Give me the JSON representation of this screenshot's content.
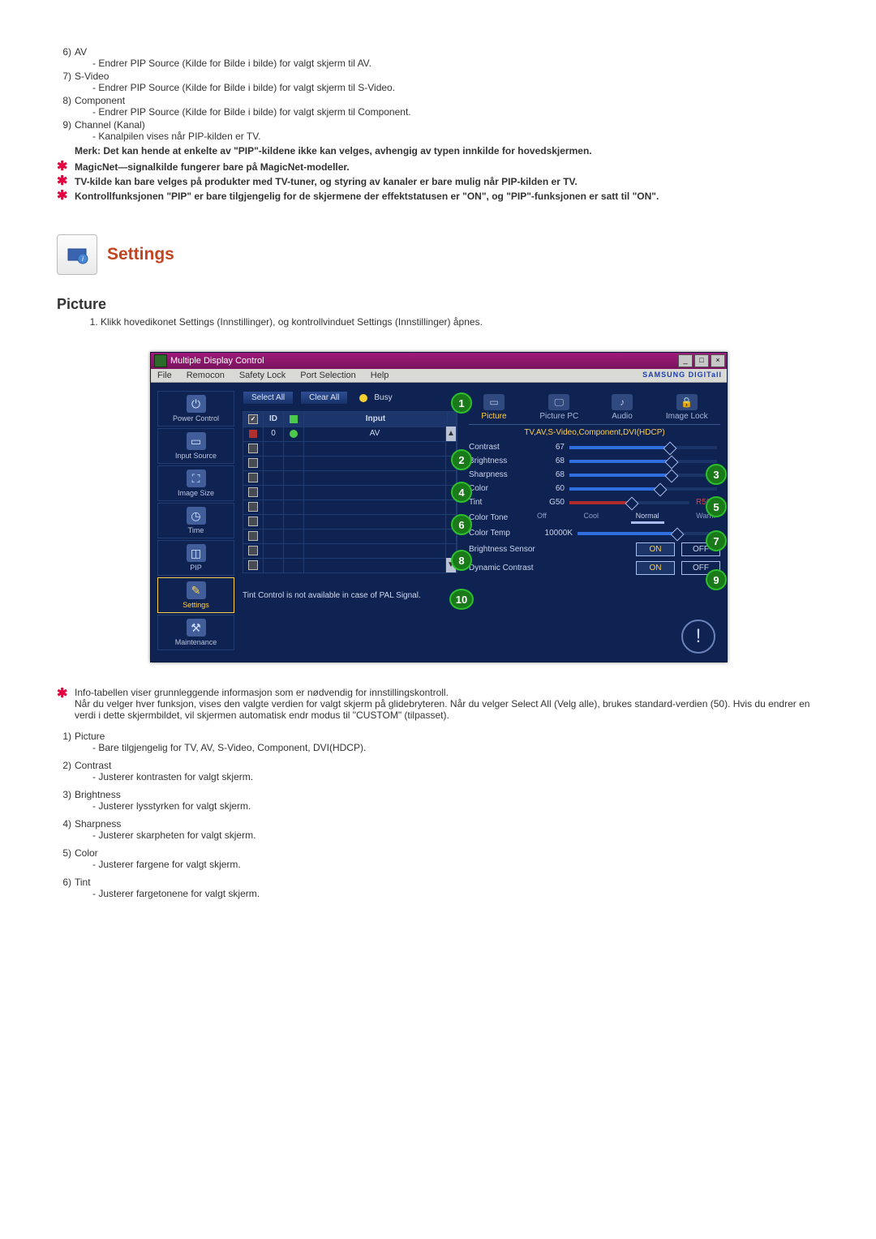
{
  "top_list": [
    {
      "num": "6)",
      "label": "AV",
      "desc": "- Endrer PIP Source (Kilde for Bilde i bilde) for valgt skjerm til AV."
    },
    {
      "num": "7)",
      "label": "S-Video",
      "desc": "- Endrer PIP Source (Kilde for Bilde i bilde) for valgt skjerm til S-Video."
    },
    {
      "num": "8)",
      "label": "Component",
      "desc": "- Endrer PIP Source (Kilde for Bilde i bilde) for valgt skjerm til Component."
    },
    {
      "num": "9)",
      "label": "Channel (Kanal)",
      "desc": "- Kanalpilen vises når PIP-kilden er TV."
    }
  ],
  "merk": "Merk: Det kan hende at enkelte av \"PIP\"-kildene ikke kan velges, avhengig av typen innkilde for hovedskjermen.",
  "star_notes": [
    "MagicNet—signalkilde fungerer bare på MagicNet-modeller.",
    "TV-kilde kan bare velges på produkter med TV-tuner, og styring av kanaler er bare mulig når PIP-kilden er TV.",
    "Kontrollfunksjonen \"PIP\" er bare tilgjengelig for de skjermene der effektstatusen er \"ON\", og \"PIP\"-funksjonen er satt til \"ON\"."
  ],
  "section_title": "Settings",
  "subsection_title": "Picture",
  "subsection_step": "Klikk hovedikonet Settings (Innstillinger), og kontrollvinduet Settings (Innstillinger) åpnes.",
  "app": {
    "title": "Multiple Display Control",
    "menu": [
      "File",
      "Remocon",
      "Safety Lock",
      "Port Selection",
      "Help"
    ],
    "brand": "SAMSUNG DIGITall",
    "sidebar": [
      {
        "label": "Power Control"
      },
      {
        "label": "Input Source"
      },
      {
        "label": "Image Size"
      },
      {
        "label": "Time"
      },
      {
        "label": "PIP"
      },
      {
        "label": "Settings"
      },
      {
        "label": "Maintenance"
      }
    ],
    "buttons": {
      "select_all": "Select All",
      "clear_all": "Clear All",
      "busy": "Busy"
    },
    "grid_headers": {
      "c1": "",
      "c2": "ID",
      "c3": "",
      "c4": "Input"
    },
    "grid_row1": {
      "id": "0",
      "input": "AV"
    },
    "tabs": [
      "Picture",
      "Picture PC",
      "Audio",
      "Image Lock"
    ],
    "panel_head": "TV,AV,S-Video,Component,DVI(HDCP)",
    "rows": {
      "contrast": {
        "label": "Contrast",
        "val": "67"
      },
      "brightness": {
        "label": "Brightness",
        "val": "68"
      },
      "sharpness": {
        "label": "Sharpness",
        "val": "68"
      },
      "color": {
        "label": "Color",
        "val": "60"
      },
      "tint": {
        "label": "Tint",
        "valL": "G50",
        "valR": "R50"
      },
      "colortone": {
        "label": "Color Tone",
        "opts": [
          "Off",
          "Cool",
          "Normal",
          "Warm"
        ]
      },
      "colortemp": {
        "label": "Color Temp",
        "val": "10000K"
      },
      "bsensor": {
        "label": "Brightness Sensor",
        "on": "ON",
        "off": "OFF"
      },
      "dcontrast": {
        "label": "Dynamic Contrast",
        "on": "ON",
        "off": "OFF"
      }
    },
    "footer_note": "Tint Control is not available in case of PAL Signal."
  },
  "post_star": "Info-tabellen viser grunnleggende informasjon som er nødvendig for innstillingskontroll.\nNår du velger hver funksjon, vises den valgte verdien for valgt skjerm på glidebryteren. Når du velger Select All (Velg alle), brukes standard-verdien (50). Hvis du endrer en verdi i dette skjermbildet, vil skjermen automatisk endr modus til \"CUSTOM\" (tilpasset).",
  "bottom_list": [
    {
      "num": "1)",
      "label": "Picture",
      "desc": "- Bare tilgjengelig for TV, AV, S-Video, Component, DVI(HDCP)."
    },
    {
      "num": "2)",
      "label": "Contrast",
      "desc": "- Justerer kontrasten for valgt skjerm."
    },
    {
      "num": "3)",
      "label": "Brightness",
      "desc": "- Justerer lysstyrken for valgt skjerm."
    },
    {
      "num": "4)",
      "label": "Sharpness",
      "desc": "- Justerer skarpheten for valgt skjerm."
    },
    {
      "num": "5)",
      "label": "Color",
      "desc": "- Justerer fargene for valgt skjerm."
    },
    {
      "num": "6)",
      "label": "Tint",
      "desc": "- Justerer fargetonene for valgt skjerm."
    }
  ]
}
